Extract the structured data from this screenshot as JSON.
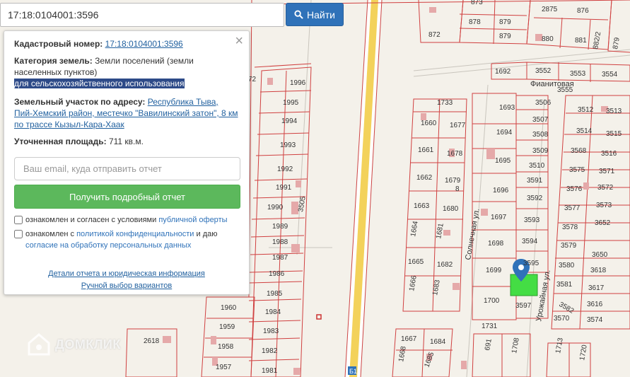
{
  "search": {
    "value": "17:18:0104001:3596",
    "button_label": "Найти"
  },
  "panel": {
    "cadastral_label": "Кадастровый номер:",
    "cadastral_value": "17:18:0104001:3596",
    "category_label": "Категория земель:",
    "category_value": "Земли поселений (земли населенных пунктов)",
    "purpose_value": "для сельскохозяйственного использования",
    "address_label": "Земельный участок по адресу:",
    "address_value": "Республика Тыва, Пий-Хемский район, местечко \"Вавилинский затон\", 8 км по трассе Кызыл-Кара-Хаак",
    "area_label": "Уточненная площадь:",
    "area_value": "711 кв.м.",
    "email_placeholder": "Ваш email, куда отправить отчет",
    "report_button": "Получить подробный отчет",
    "consent1_prefix": "ознакомлен и согласен с условиями",
    "consent1_link": "публичной оферты",
    "consent2_prefix": "ознакомлен с",
    "consent2_link": "политикой конфиденциальности",
    "consent2_mid": "и даю",
    "consent2_link2": "согласие на обработку персональных данных",
    "details_link": "Детали отчета и юридическая информация",
    "manual_link": "Ручной выбор вариантов"
  },
  "map": {
    "streets": {
      "fianitovaya": "Фианитовая",
      "solnechnaya": "Солнечная ул.",
      "urozhaynaya": "Урожайная ул."
    },
    "parcels": [
      "873",
      "876",
      "2875",
      "872",
      "878",
      "879",
      "879",
      "880",
      "881",
      "882/2",
      "879",
      "1692",
      "3552",
      "3553",
      "3554",
      "3555",
      "1693",
      "3506",
      "3507",
      "3508",
      "3509",
      "3510",
      "3512",
      "3513",
      "3514",
      "3515",
      "3516",
      "3568",
      "3571",
      "3575",
      "3572",
      "3576",
      "3573",
      "3577",
      "3652",
      "3578",
      "3650",
      "3579",
      "3618",
      "3580",
      "3617",
      "3581",
      "3616",
      "3582",
      "3574",
      "3570",
      "3597",
      "3591",
      "3592",
      "3593",
      "3594",
      "3595",
      "1694",
      "1695",
      "1696",
      "1697",
      "1698",
      "1699",
      "1700",
      "1731",
      "1733",
      "1660",
      "1677",
      "1661",
      "1678",
      "1662",
      "1679",
      "1663",
      "1680",
      "1664",
      "1681",
      "1665",
      "1682",
      "1666",
      "1683",
      "1667",
      "1684",
      "1668",
      "1685",
      "691",
      "1708",
      "1713",
      "1720",
      "1996",
      "1995",
      "1994",
      "1993",
      "1992",
      "1991",
      "1990",
      "1989",
      "1988",
      "1987",
      "1986",
      "1985",
      "1984",
      "1983",
      "1982",
      "1981",
      "1960",
      "1959",
      "1958",
      "1957",
      "2618",
      "3505",
      "72",
      "8"
    ],
    "watermark": "ДОМКЛИК"
  },
  "colors": {
    "accent": "#2f72b9",
    "success": "#5cb85c",
    "parcel_line": "#d04040",
    "selected_parcel": "#44dd44",
    "marker": "#2f72b9"
  }
}
